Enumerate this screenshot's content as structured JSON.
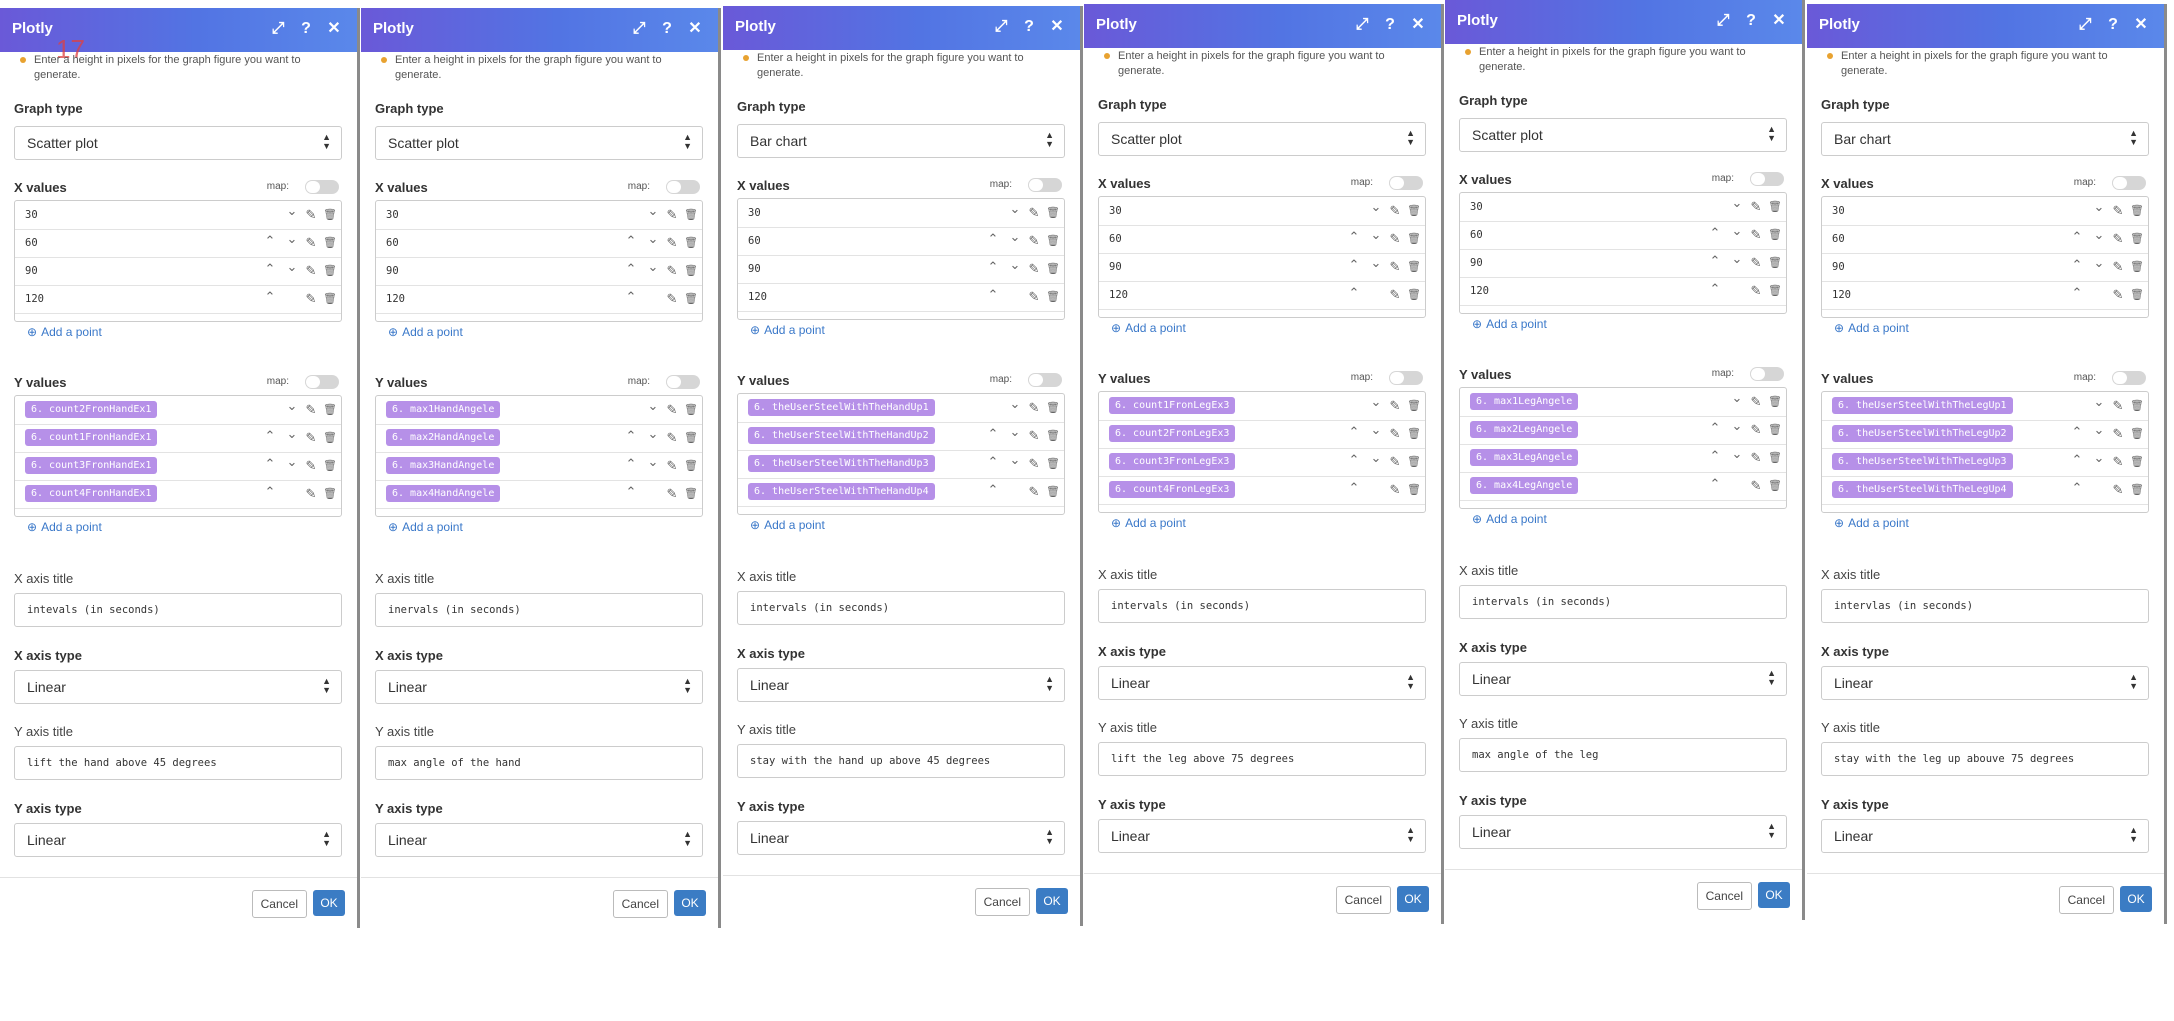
{
  "panels": [
    {
      "title": "Plotly",
      "hint": "Enter a height in pixels for the graph figure you want to generate.",
      "graph_type_label": "Graph type",
      "graph_type": "Scatter plot",
      "x_values_label": "X values",
      "map_label": "map:",
      "x_values": [
        "30",
        "60",
        "90",
        "120"
      ],
      "add_point": "Add a point",
      "y_values_label": "Y values",
      "y_values": [
        "6. count2FronHandEx1",
        "6. count1FronHandEx1",
        "6. count3FronHandEx1",
        "6. count4FronHandEx1"
      ],
      "x_axis_title_label": "X axis title",
      "x_axis_title": "intevals (in seconds)",
      "x_axis_type_label": "X axis type",
      "x_axis_type": "Linear",
      "y_axis_title_label": "Y axis title",
      "y_axis_title": "lift the hand above 45 degrees",
      "y_axis_type_label": "Y axis type",
      "y_axis_type": "Linear",
      "cancel": "Cancel",
      "ok": "OK",
      "badge": "17"
    },
    {
      "title": "Plotly",
      "hint": "Enter a height in pixels for the graph figure you want to generate.",
      "graph_type_label": "Graph type",
      "graph_type": "Scatter plot",
      "x_values_label": "X values",
      "map_label": "map:",
      "x_values": [
        "30",
        "60",
        "90",
        "120"
      ],
      "add_point": "Add a point",
      "y_values_label": "Y values",
      "y_values": [
        "6. max1HandAngele",
        "6. max2HandAngele",
        "6. max3HandAngele",
        "6. max4HandAngele"
      ],
      "x_axis_title_label": "X axis title",
      "x_axis_title": "inervals (in seconds)",
      "x_axis_type_label": "X axis type",
      "x_axis_type": "Linear",
      "y_axis_title_label": "Y axis title",
      "y_axis_title": "max angle of the hand",
      "y_axis_type_label": "Y axis type",
      "y_axis_type": "Linear",
      "cancel": "Cancel",
      "ok": "OK"
    },
    {
      "title": "Plotly",
      "hint": "Enter a height in pixels for the graph figure you want to generate.",
      "graph_type_label": "Graph type",
      "graph_type": "Bar chart",
      "x_values_label": "X values",
      "map_label": "map:",
      "x_values": [
        "30",
        "60",
        "90",
        "120"
      ],
      "add_point": "Add a point",
      "y_values_label": "Y values",
      "y_values": [
        "6. theUserSteelWithTheHandUp1",
        "6. theUserSteelWithTheHandUp2",
        "6. theUserSteelWithTheHandUp3",
        "6. theUserSteelWithTheHandUp4"
      ],
      "x_axis_title_label": "X axis title",
      "x_axis_title": "intervals (in seconds)",
      "x_axis_type_label": "X axis type",
      "x_axis_type": "Linear",
      "y_axis_title_label": "Y axis title",
      "y_axis_title": "stay with the hand up above 45 degrees",
      "y_axis_type_label": "Y axis type",
      "y_axis_type": "Linear",
      "cancel": "Cancel",
      "ok": "OK"
    },
    {
      "title": "Plotly",
      "hint": "Enter a height in pixels for the graph figure you want to generate.",
      "graph_type_label": "Graph type",
      "graph_type": "Scatter plot",
      "x_values_label": "X values",
      "map_label": "map:",
      "x_values": [
        "30",
        "60",
        "90",
        "120"
      ],
      "add_point": "Add a point",
      "y_values_label": "Y values",
      "y_values": [
        "6. count1FronLegEx3",
        "6. count2FronLegEx3",
        "6. count3FronLegEx3",
        "6. count4FronLegEx3"
      ],
      "x_axis_title_label": "X axis title",
      "x_axis_title": "intervals (in seconds)",
      "x_axis_type_label": "X axis type",
      "x_axis_type": "Linear",
      "y_axis_title_label": "Y axis title",
      "y_axis_title": "lift the leg above 75 degrees",
      "y_axis_type_label": "Y axis type",
      "y_axis_type": "Linear",
      "cancel": "Cancel",
      "ok": "OK"
    },
    {
      "title": "Plotly",
      "hint": "Enter a height in pixels for the graph figure you want to generate.",
      "graph_type_label": "Graph type",
      "graph_type": "Scatter plot",
      "x_values_label": "X values",
      "map_label": "map:",
      "x_values": [
        "30",
        "60",
        "90",
        "120"
      ],
      "add_point": "Add a point",
      "y_values_label": "Y values",
      "y_values": [
        "6. max1LegAngele",
        "6. max2LegAngele",
        "6. max3LegAngele",
        "6. max4LegAngele"
      ],
      "x_axis_title_label": "X axis title",
      "x_axis_title": "intervals (in seconds)",
      "x_axis_type_label": "X axis type",
      "x_axis_type": "Linear",
      "y_axis_title_label": "Y axis title",
      "y_axis_title": "max angle of the leg",
      "y_axis_type_label": "Y axis type",
      "y_axis_type": "Linear",
      "cancel": "Cancel",
      "ok": "OK"
    },
    {
      "title": "Plotly",
      "hint": "Enter a height in pixels for the graph figure you want to generate.",
      "graph_type_label": "Graph type",
      "graph_type": "Bar chart",
      "x_values_label": "X values",
      "map_label": "map:",
      "x_values": [
        "30",
        "60",
        "90",
        "120"
      ],
      "add_point": "Add a point",
      "y_values_label": "Y values",
      "y_values": [
        "6. theUserSteelWithTheLegUp1",
        "6. theUserSteelWithTheLegUp2",
        "6. theUserSteelWithTheLegUp3",
        "6. theUserSteelWithTheLegUp4"
      ],
      "x_axis_title_label": "X axis title",
      "x_axis_title": "intervlas (in seconds)",
      "x_axis_type_label": "X axis type",
      "x_axis_type": "Linear",
      "y_axis_title_label": "Y axis title",
      "y_axis_title": "stay with the leg up abouve 75 degrees",
      "y_axis_type_label": "Y axis type",
      "y_axis_type": "Linear",
      "cancel": "Cancel",
      "ok": "OK"
    }
  ],
  "colors": {
    "header_start": "#6a59d8",
    "header_end": "#5a88ea",
    "pill": "#b690e8",
    "ok_button": "#3b7cc4",
    "link": "#3a78c9"
  },
  "icons": {
    "expand": "expand-icon",
    "help": "help-icon",
    "close": "close-icon",
    "up": "chevron-up-icon",
    "down": "chevron-down-icon",
    "edit": "edit-icon",
    "delete": "trash-icon"
  }
}
